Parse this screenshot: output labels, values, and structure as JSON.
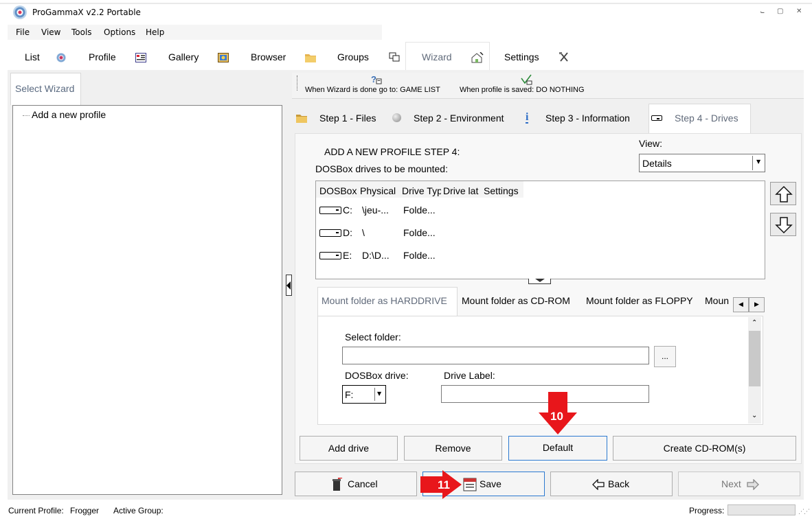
{
  "window": {
    "title": "ProGammaX v2.2 Portable",
    "min": "⨽",
    "max": "▢",
    "close": "✕"
  },
  "menu": [
    "File",
    "View",
    "Tools",
    "Options",
    "Help"
  ],
  "main_tabs": [
    "List",
    "Profile",
    "Gallery",
    "Browser",
    "Groups",
    "Wizard",
    "Settings"
  ],
  "left": {
    "tab_label": "Select Wizard",
    "tree_item": "Add a new profile"
  },
  "toolbar": {
    "wizard_done": "When Wizard is done go to: GAME LIST",
    "profile_saved": "When profile is saved: DO NOTHING"
  },
  "step_tabs": [
    "Step 1 - Files",
    "Step 2 - Environment",
    "Step 3 - Information",
    "Step 4 - Drives"
  ],
  "panel": {
    "heading": "ADD A NEW PROFILE STEP 4:",
    "subheading": "DOSBox drives to be mounted:",
    "view_label": "View:",
    "view_value": "Details"
  },
  "drives": {
    "columns": [
      "DOSBox",
      "Physical",
      "Drive Typ",
      "Drive lat",
      "Settings"
    ],
    "rows": [
      {
        "drive": "C:",
        "physical": "\\jeu-...",
        "type": "Folde..."
      },
      {
        "drive": "D:",
        "physical": "\\",
        "type": "Folde..."
      },
      {
        "drive": "E:",
        "physical": "D:\\D...",
        "type": "Folde..."
      }
    ]
  },
  "mount_tabs": [
    "Mount folder as HARDDRIVE",
    "Mount folder as CD-ROM",
    "Mount folder as FLOPPY",
    "Moun"
  ],
  "mount_form": {
    "select_folder_label": "Select folder:",
    "folder_value": "",
    "browse_label": "...",
    "dosbox_drive_label": "DOSBox drive:",
    "dosbox_drive_value": "F:",
    "drive_label_label": "Drive Label:",
    "drive_label_value": ""
  },
  "action_buttons": {
    "add": "Add drive",
    "remove": "Remove",
    "default": "Default",
    "create_cd": "Create CD-ROM(s)"
  },
  "nav_buttons": {
    "cancel": "Cancel",
    "save": "Save",
    "back": "Back",
    "next": "Next"
  },
  "markers": {
    "default_marker": "10",
    "save_marker": "11"
  },
  "status": {
    "current_profile_label": "Current Profile:",
    "current_profile_value": "Frogger",
    "active_group_label": "Active Group:",
    "active_group_value": "",
    "progress_label": "Progress:"
  },
  "colors": {
    "accent": "#2b79d0",
    "marker": "#e8161b",
    "active_tab_text": "#606a7a"
  }
}
